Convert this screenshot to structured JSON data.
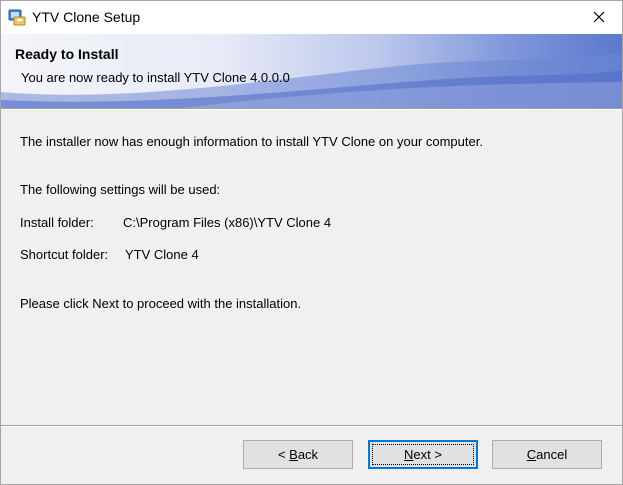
{
  "window": {
    "title": "YTV Clone Setup",
    "icon": "installer-app-icon",
    "close_icon": "close-icon"
  },
  "header": {
    "title": "Ready to Install",
    "subtitle": "You are now ready to install YTV Clone 4.0.0.0"
  },
  "body": {
    "intro": "The installer now has enough information to install YTV Clone on your computer.",
    "settings_heading": "The following settings will be used:",
    "install_folder_label": "Install folder:",
    "install_folder_value": "C:\\Program Files (x86)\\YTV Clone 4",
    "shortcut_folder_label": "Shortcut folder:",
    "shortcut_folder_value": "YTV Clone 4",
    "instruction": "Please click Next to proceed with the installation."
  },
  "buttons": {
    "back": {
      "prefix": "< ",
      "accel": "B",
      "rest": "ack"
    },
    "next": {
      "accel": "N",
      "rest": "ext >"
    },
    "cancel": {
      "accel": "C",
      "rest": "ancel"
    }
  }
}
